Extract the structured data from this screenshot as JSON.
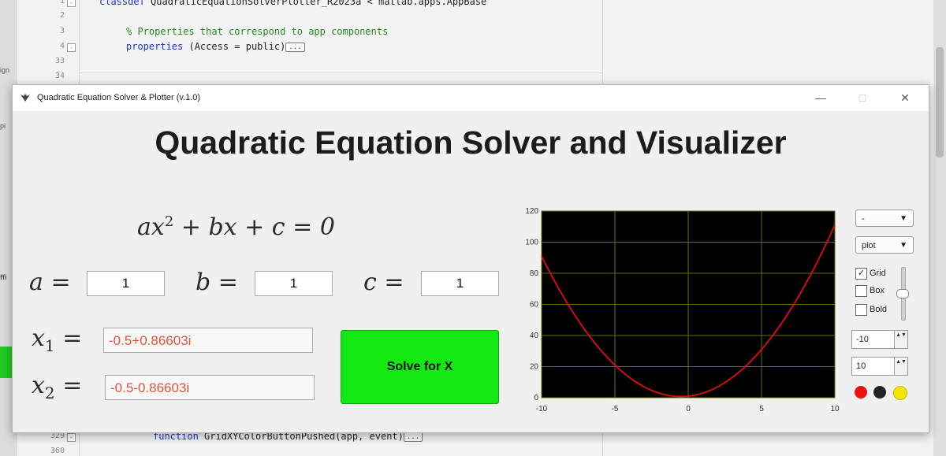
{
  "editor": {
    "line_numbers": [
      "1",
      "2",
      "3",
      "4",
      "33",
      "34",
      "329",
      "360"
    ],
    "class_decl_keyword": "classdef",
    "class_decl_rest": " QuadraticEquationSolverPlotter_R2023a < matlab.apps.AppBase",
    "comment_line": "% Properties that correspond to app components",
    "properties_keyword": "properties",
    "properties_rest": " (Access = public)",
    "function_keyword": "function",
    "function_rest": " GridXYColorButtonPushed(app, event)",
    "fold_symbol": "...",
    "left_tabs": [
      "ign",
      "pi",
      "ffi"
    ]
  },
  "window": {
    "title": "Quadratic Equation Solver & Plotter (v.1.0)",
    "minimize_symbol": "—",
    "maximize_symbol": "□",
    "close_symbol": "✕"
  },
  "app": {
    "heading": "Quadratic Equation Solver and Visualizer",
    "equation": {
      "a": "ax",
      "sup": "2",
      "rest": " + bx + c = 0"
    },
    "coefficients": [
      {
        "name": "a",
        "value": "1"
      },
      {
        "name": "b",
        "value": "1"
      },
      {
        "name": "c",
        "value": "1"
      }
    ],
    "equals": "=",
    "roots": [
      {
        "base": "x",
        "sub": "1",
        "value": "-0.5+0.86603i"
      },
      {
        "base": "x",
        "sub": "2",
        "value": "-0.5-0.86603i"
      }
    ],
    "solve_button_label": "Solve for X"
  },
  "controls": {
    "line_style": "-",
    "plot_type": "plot",
    "grid_label": "Grid",
    "grid_checked": true,
    "box_label": "Box",
    "box_checked": false,
    "bold_label": "Bold",
    "bold_checked": false,
    "x_min": "-10",
    "x_max": "10",
    "line_width_slider_fraction": 0.5,
    "color_buttons": [
      "#ee1111",
      "#222222",
      "#f5e600"
    ],
    "caret": "▼",
    "spin_arrows": "▲▼"
  },
  "chart_data": {
    "type": "line",
    "title": "",
    "xlabel": "",
    "ylabel": "",
    "xlim": [
      -10,
      10
    ],
    "ylim": [
      0,
      120
    ],
    "xticks": [
      "-10",
      "-5",
      "0",
      "5",
      "10"
    ],
    "yticks": [
      "0",
      "20",
      "40",
      "60",
      "80",
      "100",
      "120"
    ],
    "grid": true,
    "background": "#000000",
    "grid_color": "#6b6b00",
    "line_color": "#cc1010",
    "series": [
      {
        "function": "y = x^2 + x + 1",
        "x": [
          -10,
          -8,
          -6,
          -4,
          -2,
          -1,
          -0.5,
          0,
          2,
          4,
          6,
          8,
          10
        ],
        "y": [
          91,
          57,
          31,
          13,
          3,
          1,
          0.75,
          1,
          7,
          21,
          43,
          73,
          111
        ]
      }
    ]
  }
}
